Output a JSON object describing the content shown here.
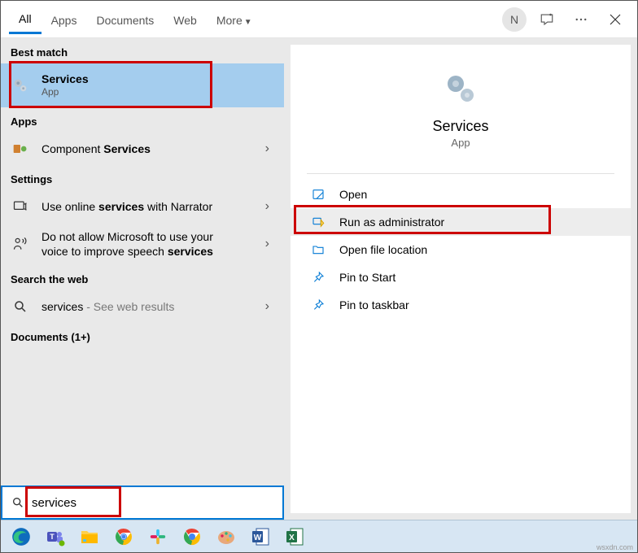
{
  "tabs": {
    "all": "All",
    "apps": "Apps",
    "documents": "Documents",
    "web": "Web",
    "more": "More"
  },
  "avatar_initial": "N",
  "sections": {
    "best_match": "Best match",
    "apps": "Apps",
    "settings": "Settings",
    "search_web": "Search the web",
    "documents": "Documents (1+)"
  },
  "best": {
    "title": "Services",
    "sub": "App"
  },
  "apps_result": {
    "prefix": "Component ",
    "bold": "Services"
  },
  "settings1": {
    "prefix": "Use online ",
    "bold": "services",
    "suffix": " with Narrator"
  },
  "settings2_line1": "Do not allow Microsoft to use your",
  "settings2_prefix": "voice to improve speech ",
  "settings2_bold": "services",
  "web_result": {
    "term": "services",
    "suffix": " - See web results"
  },
  "preview": {
    "title": "Services",
    "sub": "App"
  },
  "actions": {
    "open": "Open",
    "run_admin": "Run as administrator",
    "open_loc": "Open file location",
    "pin_start": "Pin to Start",
    "pin_taskbar": "Pin to taskbar"
  },
  "search_value": "services",
  "watermark": "wsxdn.com"
}
